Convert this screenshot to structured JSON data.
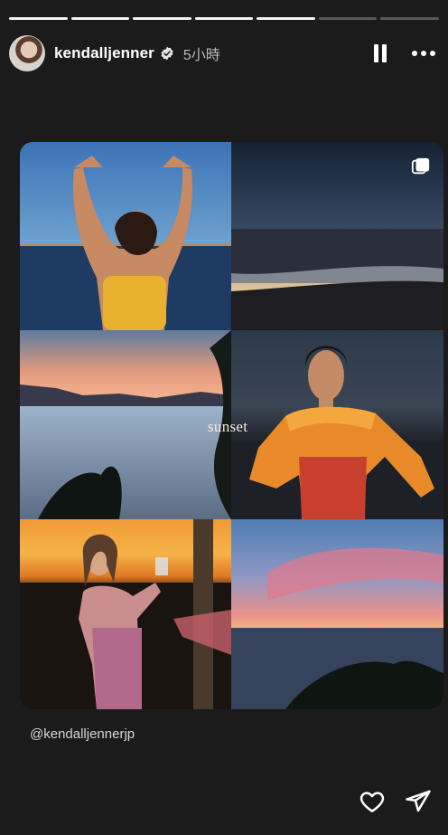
{
  "story": {
    "progress": {
      "total": 7,
      "viewed": 5
    },
    "user": {
      "username": "kendalljenner",
      "verified": true,
      "time": "5小時"
    },
    "controls": {
      "pause_icon": "pause-icon",
      "more_icon": "more-options-icon"
    },
    "post": {
      "overlay_text": "sunset",
      "multi_icon": "carousel-icon",
      "photos": [
        "woman-arms-raised-sunset-sea",
        "sunset-ocean-beach",
        "sunset-lake-trees",
        "woman-orange-dress-portrait",
        "woman-holding-drink-sunset",
        "pink-sky-sunset-sea"
      ]
    },
    "mention": "@kendalljennerjp",
    "actions": {
      "like_icon": "heart-icon",
      "share_icon": "send-icon"
    }
  }
}
